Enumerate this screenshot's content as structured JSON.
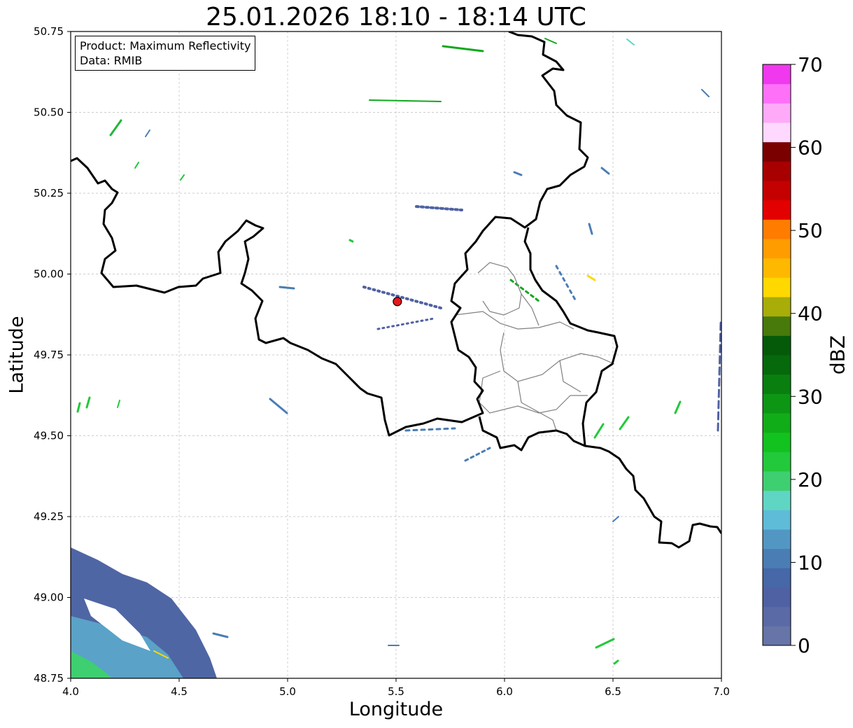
{
  "title": "25.01.2026 18:10 - 18:14 UTC",
  "info": {
    "line1": "Product: Maximum Reflectivity",
    "line2": "Data: RMIB"
  },
  "map": {
    "xlabel": "Longitude",
    "ylabel": "Latitude",
    "xlim": [
      4.0,
      7.0
    ],
    "ylim": [
      48.75,
      50.75
    ],
    "xticks": [
      "4.0",
      "4.5",
      "5.0",
      "5.5",
      "6.0",
      "6.5",
      "7.0"
    ],
    "yticks": [
      "48.75",
      "49.00",
      "49.25",
      "49.50",
      "49.75",
      "50.00",
      "50.25",
      "50.50",
      "50.75"
    ],
    "grid": true,
    "radar_site": {
      "lon": 5.506,
      "lat": 49.915,
      "color": "#e31a1c"
    },
    "border_color": "#000000",
    "district_color": "#808080"
  },
  "colorbar": {
    "label": "dBZ",
    "min": 0,
    "max": 70,
    "ticks": [
      "0",
      "10",
      "20",
      "30",
      "40",
      "50",
      "60",
      "70"
    ],
    "colors": [
      "#6674a7",
      "#5a6aa6",
      "#4f61a3",
      "#4667a8",
      "#4a7db4",
      "#5297c4",
      "#5ebcd9",
      "#5fd6c4",
      "#3ecf70",
      "#22c93a",
      "#12c21e",
      "#10ad18",
      "#0c9614",
      "#097f10",
      "#06690c",
      "#045a08",
      "#477a0a",
      "#a8ad08",
      "#ffd800",
      "#ffb800",
      "#ff9c00",
      "#ff7c00",
      "#e30000",
      "#c40000",
      "#a80000",
      "#7a0000",
      "#ffd8ff",
      "#ffaaf8",
      "#ff70f8",
      "#f038ee"
    ]
  }
}
